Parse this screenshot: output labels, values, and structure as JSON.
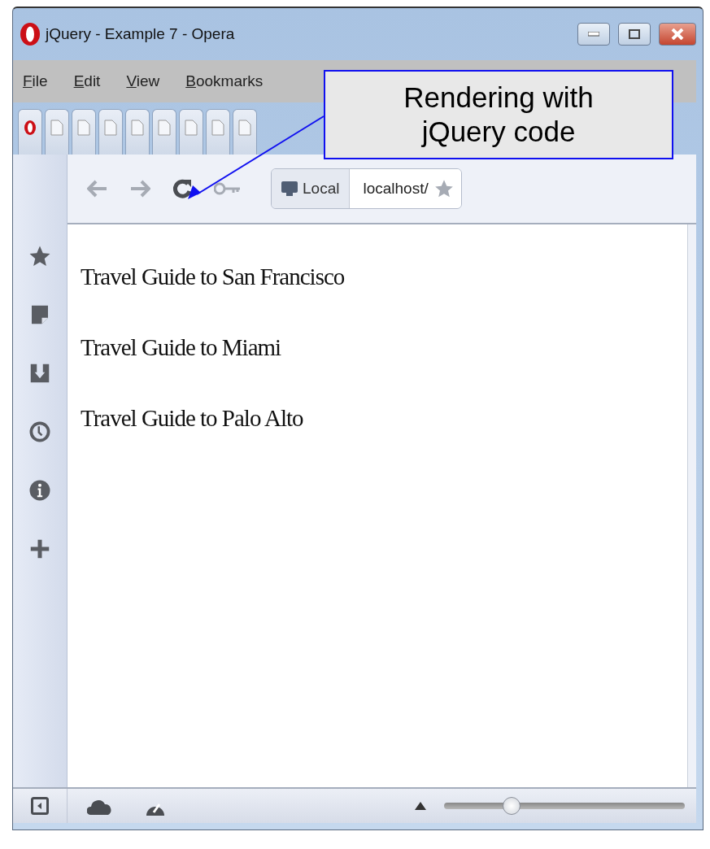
{
  "window": {
    "title": "jQuery - Example 7 - Opera"
  },
  "menu": [
    "File",
    "Edit",
    "View",
    "Bookmarks"
  ],
  "tabs": [
    {
      "kind": "opera"
    },
    {
      "kind": "page"
    },
    {
      "kind": "page"
    },
    {
      "kind": "page"
    },
    {
      "kind": "page"
    },
    {
      "kind": "page"
    },
    {
      "kind": "page"
    },
    {
      "kind": "page"
    },
    {
      "kind": "page"
    }
  ],
  "address_bar": {
    "badge": "Local",
    "url": "localhost/"
  },
  "sidebar": {
    "items": [
      {
        "kind": "star"
      },
      {
        "kind": "note"
      },
      {
        "kind": "download"
      },
      {
        "kind": "clock"
      },
      {
        "kind": "info"
      },
      {
        "kind": "plus"
      }
    ]
  },
  "content": {
    "paragraphs": [
      "Travel Guide to San Francisco",
      "Travel Guide to Miami",
      "Travel Guide to Palo Alto"
    ]
  },
  "callout": {
    "text": "Rendering with jQuery code"
  },
  "status_bar": {
    "zoom": {
      "level": 0.28
    }
  }
}
